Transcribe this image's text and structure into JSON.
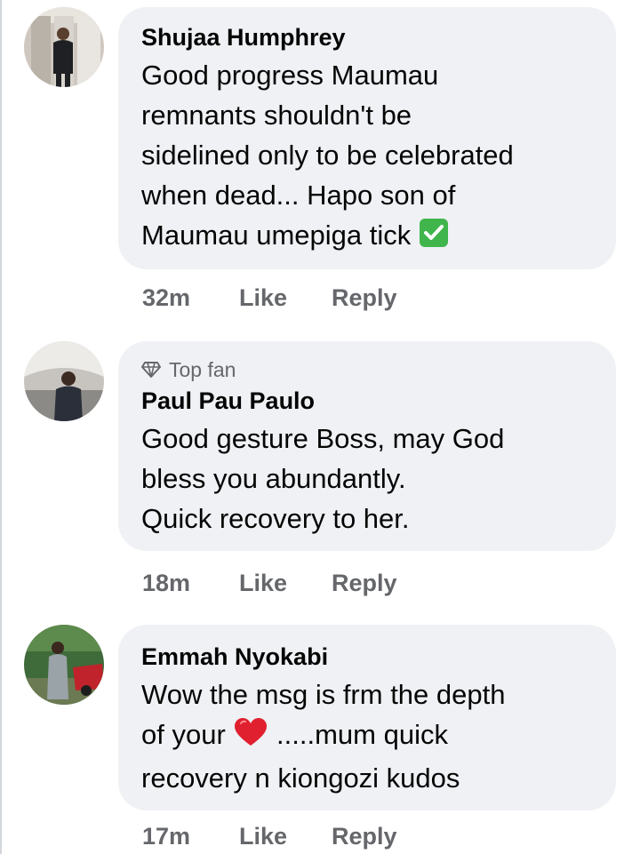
{
  "comments": [
    {
      "author": "Shujaa Humphrey",
      "badge": "",
      "lines": [
        "Good progress Maumau",
        "remnants shouldn't be",
        "sidelined only to be celebrated",
        "when dead... Hapo son of",
        "Maumau umepiga tick"
      ],
      "emoji": "check-mark-button",
      "time": "32m",
      "like": "Like",
      "reply": "Reply"
    },
    {
      "author": "Paul Pau Paulo",
      "badge": "Top fan",
      "badge_icon": "diamond-icon",
      "lines": [
        "Good gesture Boss,  may God",
        "bless you abundantly.",
        "Quick recovery to her."
      ],
      "time": "18m",
      "like": "Like",
      "reply": "Reply"
    },
    {
      "author": "Emmah Nyokabi",
      "badge": "",
      "lines": [
        "Wow the msg is frm the depth",
        "of your",
        ".....mum quick",
        "recovery n kiongozi kudos"
      ],
      "emoji": "red-heart",
      "time": "17m",
      "like": "Like",
      "reply": "Reply"
    }
  ],
  "colors": {
    "bubble": "#eff1f4",
    "text": "#050505",
    "secondary": "#65676b",
    "check_green": "#3fb54b",
    "heart_red": "#e0202f"
  }
}
